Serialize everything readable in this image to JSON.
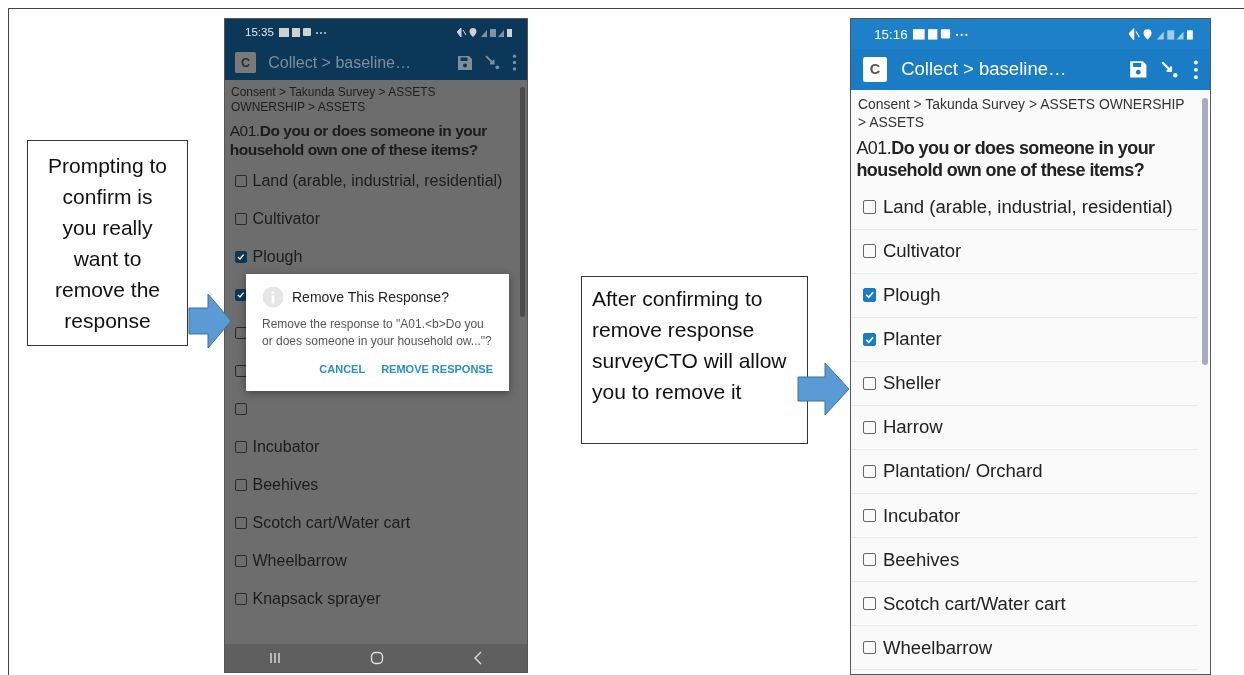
{
  "slide": {
    "phones": [
      {
        "dimmed": true,
        "status_bar": {
          "time": "15:35"
        },
        "toolbar": {
          "logo": "C",
          "title": "Collect > baseline…"
        },
        "breadcrumb": "Consent > Takunda Survey > ASSETS OWNERSHIP > ASSETS",
        "question": "A01.**Do you or does someone in your household own one of these items?**",
        "options": [
          {
            "label": "Land (arable, industrial, residential)",
            "checked": false
          },
          {
            "label": "Cultivator",
            "checked": false
          },
          {
            "label": "Plough",
            "checked": true
          },
          {
            "checked": true
          },
          {
            "checked": false
          },
          {
            "checked": false
          },
          {
            "checked": false
          },
          {
            "label": "Incubator",
            "checked": false
          },
          {
            "label": "Beehives",
            "checked": false
          },
          {
            "label": "Scotch cart/Water cart",
            "checked": false
          },
          {
            "label": "Wheelbarrow",
            "checked": false
          },
          {
            "label": "Knapsack sprayer",
            "checked": false
          }
        ],
        "dialog": {
          "title": "Remove This Response?",
          "message": "Remove the response to \"A01.<b>Do you or does someone in your household ow...\"?",
          "buttons": [
            "CANCEL",
            "REMOVE RESPONSE"
          ]
        },
        "nav_bar": true
      },
      {
        "dimmed": false,
        "status_bar": {
          "time": "15:16"
        },
        "toolbar": {
          "logo": "C",
          "title": "Collect > baseline…"
        },
        "breadcrumb": "Consent > Takunda Survey > ASSETS OWNERSHIP > ASSETS",
        "question": "A01.**Do you or does someone in your household own one of these items?**",
        "options": [
          {
            "label": "Land (arable, industrial, residential)",
            "checked": false
          },
          {
            "label": "Cultivator",
            "checked": false
          },
          {
            "label": "Plough",
            "checked": true
          },
          {
            "label": "Planter",
            "checked": true
          },
          {
            "label": "Sheller",
            "checked": false
          },
          {
            "label": "Harrow",
            "checked": false
          },
          {
            "label": "Plantation/ Orchard",
            "checked": false
          },
          {
            "label": "Incubator",
            "checked": false
          },
          {
            "label": "Beehives",
            "checked": false
          },
          {
            "label": "Scotch cart/Water cart",
            "checked": false
          },
          {
            "label": "Wheelbarrow",
            "checked": false
          }
        ]
      }
    ],
    "callouts": [
      {
        "text": "Prompting to confirm is you really want to remove the response"
      },
      {
        "text": "After confirming to remove response surveyCTO will allow you to remove it"
      }
    ]
  }
}
